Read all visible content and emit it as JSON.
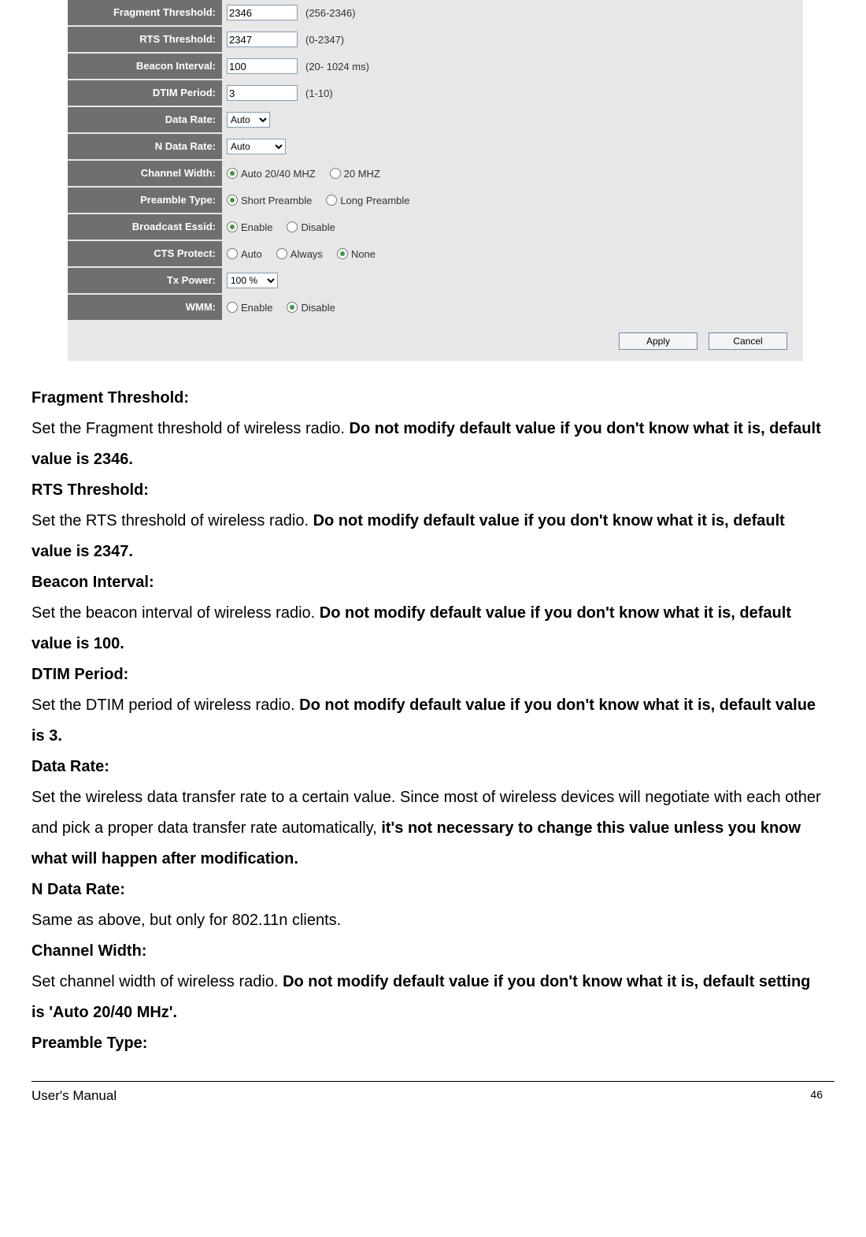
{
  "panel": {
    "rows": {
      "frag": {
        "label": "Fragment Threshold:",
        "value": "2346",
        "hint": "(256-2346)"
      },
      "rts": {
        "label": "RTS Threshold:",
        "value": "2347",
        "hint": "(0-2347)"
      },
      "beacon": {
        "label": "Beacon Interval:",
        "value": "100",
        "hint": "(20- 1024 ms)"
      },
      "dtim": {
        "label": "DTIM Period:",
        "value": "3",
        "hint": "(1-10)"
      },
      "datarate": {
        "label": "Data Rate:",
        "value": "Auto"
      },
      "ndatarate": {
        "label": "N Data Rate:",
        "value": "Auto"
      },
      "chwidth": {
        "label": "Channel Width:",
        "opt1": "Auto 20/40 MHZ",
        "opt2": "20 MHZ"
      },
      "preamble": {
        "label": "Preamble Type:",
        "opt1": "Short Preamble",
        "opt2": "Long Preamble"
      },
      "bcast": {
        "label": "Broadcast Essid:",
        "opt1": "Enable",
        "opt2": "Disable"
      },
      "cts": {
        "label": "CTS Protect:",
        "opt1": "Auto",
        "opt2": "Always",
        "opt3": "None"
      },
      "txpower": {
        "label": "Tx Power:",
        "value": "100 %"
      },
      "wmm": {
        "label": "WMM:",
        "opt1": "Enable",
        "opt2": "Disable"
      }
    },
    "buttons": {
      "apply": "Apply",
      "cancel": "Cancel"
    }
  },
  "doc": {
    "frag_h": "Fragment Threshold:",
    "frag_t1": "Set the Fragment threshold of wireless radio. ",
    "frag_b": "Do not modify default value if you don't know what it is, default value is 2346.",
    "rts_h": "RTS Threshold:",
    "rts_t1": "Set the RTS threshold of wireless radio. ",
    "rts_b": "Do not modify default value if you don't know what it is, default value is 2347.",
    "beacon_h": "Beacon Interval:",
    "beacon_t1": "Set the beacon interval of wireless radio. ",
    "beacon_b": "Do not modify default value if you don't know what it is, default value is 100.",
    "dtim_h": "DTIM Period:",
    "dtim_t1": "Set the DTIM period of wireless radio. ",
    "dtim_b": "Do not modify default value if you don't know what it is, default value is 3.",
    "dr_h": "Data Rate:",
    "dr_t1": "Set the wireless data transfer rate to a certain value. Since most of wireless devices will negotiate with each other and pick a proper data transfer rate automatically, ",
    "dr_b": "it's not necessary to change this value unless you know what will happen after modification.",
    "ndr_h": "N Data Rate:",
    "ndr_t": "Same as above, but only for 802.11n clients.",
    "cw_h": "Channel Width:",
    "cw_t1": "Set channel width of wireless radio. ",
    "cw_b": "Do not modify default value if you don't know what it is, default setting is 'Auto 20/40 MHz'.",
    "pt_h": "Preamble Type:"
  },
  "footer": {
    "left": "User's Manual",
    "right": "46"
  }
}
